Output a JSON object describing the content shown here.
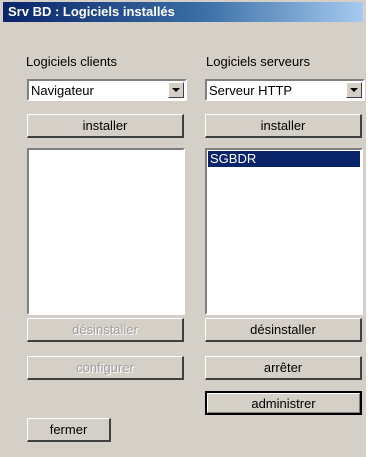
{
  "window": {
    "title": "Srv BD : Logiciels installés"
  },
  "clients": {
    "label": "Logiciels clients",
    "select_value": "Navigateur",
    "install_label": "installer",
    "items": [],
    "uninstall_label": "désinstaller",
    "configure_label": "configurer"
  },
  "servers": {
    "label": "Logiciels serveurs",
    "select_value": "Serveur HTTP",
    "install_label": "installer",
    "items": [
      "SGBDR"
    ],
    "uninstall_label": "désinstaller",
    "stop_label": "arrêter",
    "admin_label": "administrer"
  },
  "close_label": "fermer"
}
